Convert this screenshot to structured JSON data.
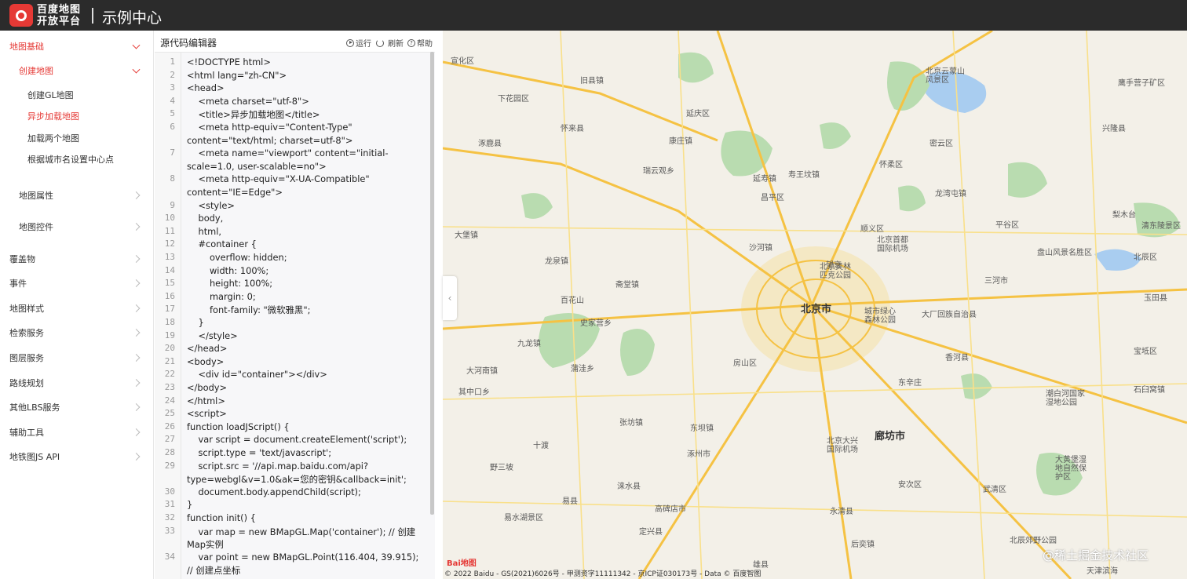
{
  "header": {
    "brand_line1": "百度地图",
    "brand_line2": "开放平台",
    "title": "示例中心"
  },
  "sidebar": {
    "items": [
      {
        "label": "地图基础",
        "state": "expanded",
        "color": "#e53935"
      },
      {
        "label": "创建地图",
        "state": "expanded",
        "color": "#e53935"
      },
      {
        "label": "创建GL地图"
      },
      {
        "label": "异步加载地图",
        "state": "selected",
        "color": "#e53935"
      },
      {
        "label": "加载两个地图"
      },
      {
        "label": "根据城市名设置中心点"
      },
      {
        "label": "地图属性"
      },
      {
        "label": "地图控件"
      },
      {
        "label": "覆盖物"
      },
      {
        "label": "事件"
      },
      {
        "label": "地图样式"
      },
      {
        "label": "检索服务"
      },
      {
        "label": "图层服务"
      },
      {
        "label": "路线规划"
      },
      {
        "label": "其他LBS服务"
      },
      {
        "label": "辅助工具"
      },
      {
        "label": "地铁图JS API"
      }
    ]
  },
  "editor": {
    "title": "源代码编辑器",
    "run_label": "运行",
    "refresh_label": "刷新",
    "help_label": "帮助",
    "line_numbers": [
      "1",
      "2",
      "3",
      "4",
      "5",
      "6",
      "",
      "7",
      "",
      "8",
      "",
      "9",
      "10",
      "11",
      "12",
      "13",
      "14",
      "15",
      "16",
      "17",
      "18",
      "19",
      "20",
      "21",
      "22",
      "23",
      "24",
      "25",
      "26",
      "27",
      "28",
      "29",
      "",
      "30",
      "31",
      "32",
      "33",
      "",
      "34",
      ""
    ],
    "code_lines": [
      "<!DOCTYPE html>",
      "<html lang=\"zh-CN\">",
      "<head>",
      "    <meta charset=\"utf-8\">",
      "    <title>异步加载地图</title>",
      "    <meta http-equiv=\"Content-Type\"",
      "content=\"text/html; charset=utf-8\">",
      "    <meta name=\"viewport\" content=\"initial-",
      "scale=1.0, user-scalable=no\">",
      "    <meta http-equiv=\"X-UA-Compatible\"",
      "content=\"IE=Edge\">",
      "    <style>",
      "    body,",
      "    html,",
      "    #container {",
      "        overflow: hidden;",
      "        width: 100%;",
      "        height: 100%;",
      "        margin: 0;",
      "        font-family: \"微软雅黑\";",
      "    }",
      "    </style>",
      "</head>",
      "<body>",
      "    <div id=\"container\"></div>",
      "</body>",
      "</html>",
      "<script>",
      "function loadJScript() {",
      "    var script = document.createElement('script');",
      "    script.type = 'text/javascript';",
      "    script.src = '//api.map.baidu.com/api?",
      "type=webgl&v=1.0&ak=您的密钥&callback=init';",
      "    document.body.appendChild(script);",
      "}",
      "function init() {",
      "    var map = new BMapGL.Map('container'); // 创建",
      "Map实例",
      "    var point = new BMapGL.Point(116.404, 39.915);",
      "// 创建点坐标"
    ]
  },
  "map": {
    "cities": [
      "北京市",
      "廊坊市"
    ],
    "places": [
      "宣化区",
      "旧县镇",
      "下花园区",
      "延庆区",
      "怀来县",
      "康庄镇",
      "北京云蒙山风景区",
      "涿鹿县",
      "瑞云观乡",
      "怀柔区",
      "密云区",
      "兴隆县",
      "鹰手营子矿区",
      "昌平区",
      "龙湾屯镇",
      "顺义区",
      "北京首都国际机场",
      "北京奥林匹克公园",
      "平谷区",
      "梨木台",
      "清东陵景区",
      "盘山风景名胜区",
      "三河市",
      "大厂回族自治县",
      "城市绿心森林公园",
      "大堡镇",
      "斋堂镇",
      "史家营乡",
      "九龙镇",
      "房山区",
      "香河县",
      "大河南镇",
      "蒲洼乡",
      "其中口乡",
      "潮白河国家湿地公园",
      "石臼窝镇",
      "张坊镇",
      "东坝镇",
      "北京大兴国际机场",
      "涿州市",
      "涞水县",
      "大黄堡湿地自然保护区",
      "易县",
      "高碑店市",
      "永清县",
      "武清区",
      "易水湖景区",
      "定兴县",
      "北辰郊野公园",
      "后奕镇",
      "雄县",
      "天津滨海",
      "寿王坟镇",
      "玉田县",
      "北辰区",
      "野三坡",
      "望京",
      "沙河镇",
      "龙泉镇",
      "延寿镇",
      "百花山",
      "十渡",
      "宝坻区",
      "安次区",
      "东辛庄"
    ],
    "collapse_icon": "chevron-left-icon",
    "baidu_logo": "Bai地图",
    "copyright": "© 2022 Baidu - GS(2021)6026号 - 甲测资字11111342 - 京ICP证030173号 - Data © 百度智图",
    "watermark": "@稀土掘金技术社区",
    "colors": {
      "land": "#f3f0e8",
      "green": "#b9dcb0",
      "water": "#a9cdf0",
      "highway": "#f5c243",
      "road": "#f9e08a",
      "urban": "#f4e8c4"
    }
  }
}
